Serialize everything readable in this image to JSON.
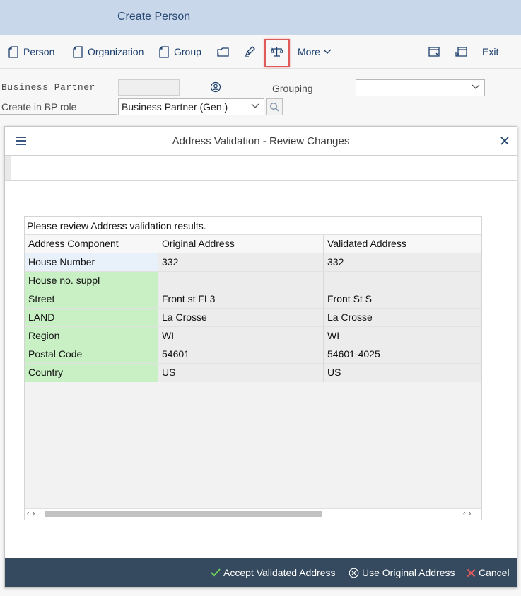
{
  "header": {
    "title": "Create Person"
  },
  "toolbar": {
    "person_label": "Person",
    "organization_label": "Organization",
    "group_label": "Group",
    "more_label": "More",
    "exit_label": "Exit",
    "icons": [
      "new-document-icon",
      "open-folder-icon",
      "edit-pencil-icon",
      "balance-scale-icon",
      "chevron-down-icon",
      "calendar-window-icon",
      "exit-window-icon"
    ]
  },
  "form": {
    "business_partner_label": "Business Partner",
    "business_partner_value": "",
    "grouping_label": "Grouping",
    "grouping_value": "",
    "bp_role_label": "Create in BP role",
    "bp_role_value": "Business Partner (Gen.)"
  },
  "dialog": {
    "title": "Address Validation - Review Changes",
    "caption": "Please review Address validation results.",
    "columns": [
      "Address Component",
      "Original Address",
      "Validated Address"
    ],
    "rows": [
      {
        "component": "House Number",
        "original": "332",
        "validated": "332",
        "status": "blue"
      },
      {
        "component": "House no. suppl",
        "original": "",
        "validated": "",
        "status": "green"
      },
      {
        "component": "Street",
        "original": "Front st FL3",
        "validated": "Front St S",
        "status": "green"
      },
      {
        "component": "LAND",
        "original": "La Crosse",
        "validated": "La Crosse",
        "status": "green"
      },
      {
        "component": "Region",
        "original": "WI",
        "validated": "WI",
        "status": "green"
      },
      {
        "component": "Postal Code",
        "original": "54601",
        "validated": "54601-4025",
        "status": "green"
      },
      {
        "component": "Country",
        "original": "US",
        "validated": "US",
        "status": "green"
      }
    ],
    "footer": {
      "accept_label": "Accept Validated Address",
      "use_original_label": "Use Original Address",
      "cancel_label": "Cancel"
    }
  },
  "colors": {
    "title_bar": "#c9d7ea",
    "highlight_border": "#e05a5a",
    "changed_row": "#c8f0c4",
    "selected_cell": "#e8f0fa",
    "footer_bar": "#354a5f",
    "accept_check": "#6fcf5a",
    "cancel_x": "#e05a5a"
  }
}
